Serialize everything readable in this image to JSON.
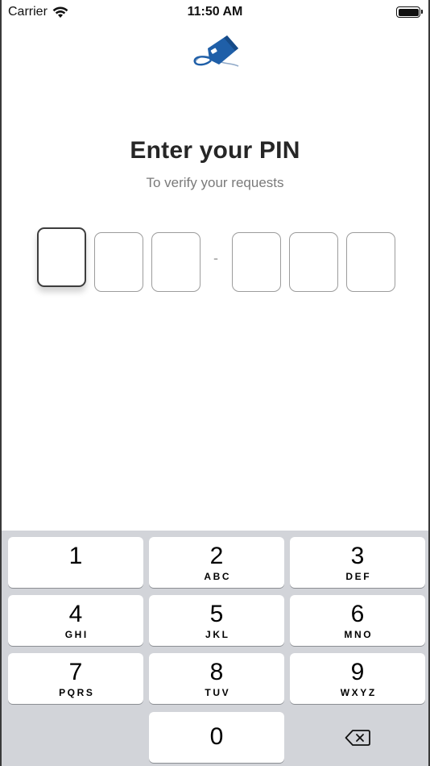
{
  "status_bar": {
    "carrier": "Carrier",
    "time": "11:50 AM"
  },
  "header": {
    "title": "Enter your PIN",
    "subtitle": "To verify your requests"
  },
  "pin": {
    "separator": "-",
    "digits": [
      "",
      "",
      "",
      "",
      "",
      ""
    ],
    "active_index": 0
  },
  "keypad": {
    "keys": [
      {
        "digit": "1",
        "letters": ""
      },
      {
        "digit": "2",
        "letters": "ABC"
      },
      {
        "digit": "3",
        "letters": "DEF"
      },
      {
        "digit": "4",
        "letters": "GHI"
      },
      {
        "digit": "5",
        "letters": "JKL"
      },
      {
        "digit": "6",
        "letters": "MNO"
      },
      {
        "digit": "7",
        "letters": "PQRS"
      },
      {
        "digit": "8",
        "letters": "TUV"
      },
      {
        "digit": "9",
        "letters": "WXYZ"
      },
      {
        "digit": "0",
        "letters": ""
      }
    ],
    "backspace_icon": "delete-backward-icon"
  },
  "colors": {
    "logo_blue": "#1f5fa8",
    "keyboard_bg": "#d2d4d9",
    "title": "#262626",
    "subtitle": "#7a7a7a"
  }
}
